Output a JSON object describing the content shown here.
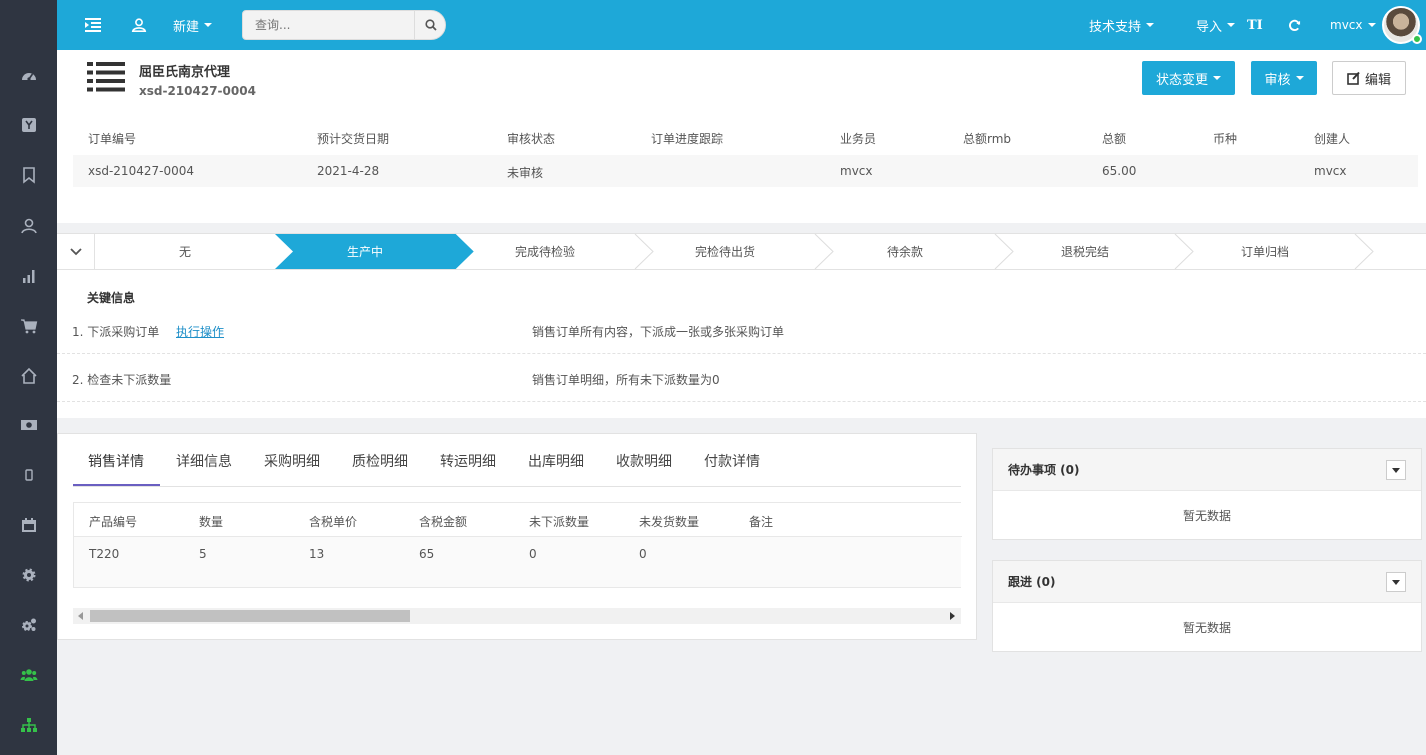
{
  "sidebar": {
    "items": [
      {
        "icon": "dashboard-icon",
        "color": "#aab1bd"
      },
      {
        "icon": "y-square-icon",
        "color": "#aab1bd"
      },
      {
        "icon": "bookmark-icon",
        "color": "#aab1bd"
      },
      {
        "icon": "user-icon",
        "color": "#aab1bd"
      },
      {
        "icon": "bar-chart-icon",
        "color": "#aab1bd"
      },
      {
        "icon": "shopping-cart-icon",
        "color": "#aab1bd"
      },
      {
        "icon": "home-icon",
        "color": "#aab1bd"
      },
      {
        "icon": "money-icon",
        "color": "#aab1bd"
      },
      {
        "icon": "mobile-icon",
        "color": "#aab1bd"
      },
      {
        "icon": "calendar-icon",
        "color": "#aab1bd"
      },
      {
        "icon": "gear-icon",
        "color": "#aab1bd"
      },
      {
        "icon": "gears-icon",
        "color": "#aab1bd"
      },
      {
        "icon": "users-icon",
        "color": "#35c24a"
      },
      {
        "icon": "sitemap-icon",
        "color": "#35c24a"
      }
    ]
  },
  "topbar": {
    "new_label": "新建",
    "search_placeholder": "查询...",
    "support_label": "技术支持",
    "import_label": "导入",
    "font_label": "TI",
    "user_label": "mvcx",
    "accent": "#1ea8d8"
  },
  "header": {
    "company": "屈臣氏南京代理",
    "order_code": "xsd-210427-0004",
    "status_btn": "状态变更",
    "audit_btn": "审核",
    "edit_btn": "编辑"
  },
  "info_table": {
    "columns": [
      "订单编号",
      "预计交货日期",
      "审核状态",
      "订单进度跟踪",
      "业务员",
      "总额rmb",
      "总额",
      "币种",
      "创建人"
    ],
    "row": [
      "xsd-210427-0004",
      "2021-4-28",
      "未审核",
      "",
      "mvcx",
      "",
      "65.00",
      "",
      "mvcx"
    ]
  },
  "steps": {
    "items": [
      "无",
      "生产中",
      "完成待检验",
      "完检待出货",
      "待余款",
      "退税完结",
      "订单归档"
    ],
    "active_index": 1
  },
  "key_info": {
    "title": "关键信息",
    "rows": [
      {
        "label": "1. 下派采购订单",
        "link": "执行操作",
        "desc": "销售订单所有内容，下派成一张或多张采购订单"
      },
      {
        "label": "2. 检查未下派数量",
        "link": "",
        "desc": "销售订单明细，所有未下派数量为0"
      }
    ]
  },
  "detail": {
    "tabs": [
      "销售详情",
      "详细信息",
      "采购明细",
      "质检明细",
      "转运明细",
      "出库明细",
      "收款明细",
      "付款详情"
    ],
    "columns": [
      "产品编号",
      "数量",
      "含税单价",
      "含税金额",
      "未下派数量",
      "未发货数量",
      "备注"
    ],
    "row": [
      "T220",
      "5",
      "13",
      "65",
      "0",
      "0",
      ""
    ]
  },
  "todo": {
    "title": "待办事项 (0)",
    "empty": "暂无数据"
  },
  "followup": {
    "title": "跟进 (0)",
    "empty": "暂无数据"
  }
}
